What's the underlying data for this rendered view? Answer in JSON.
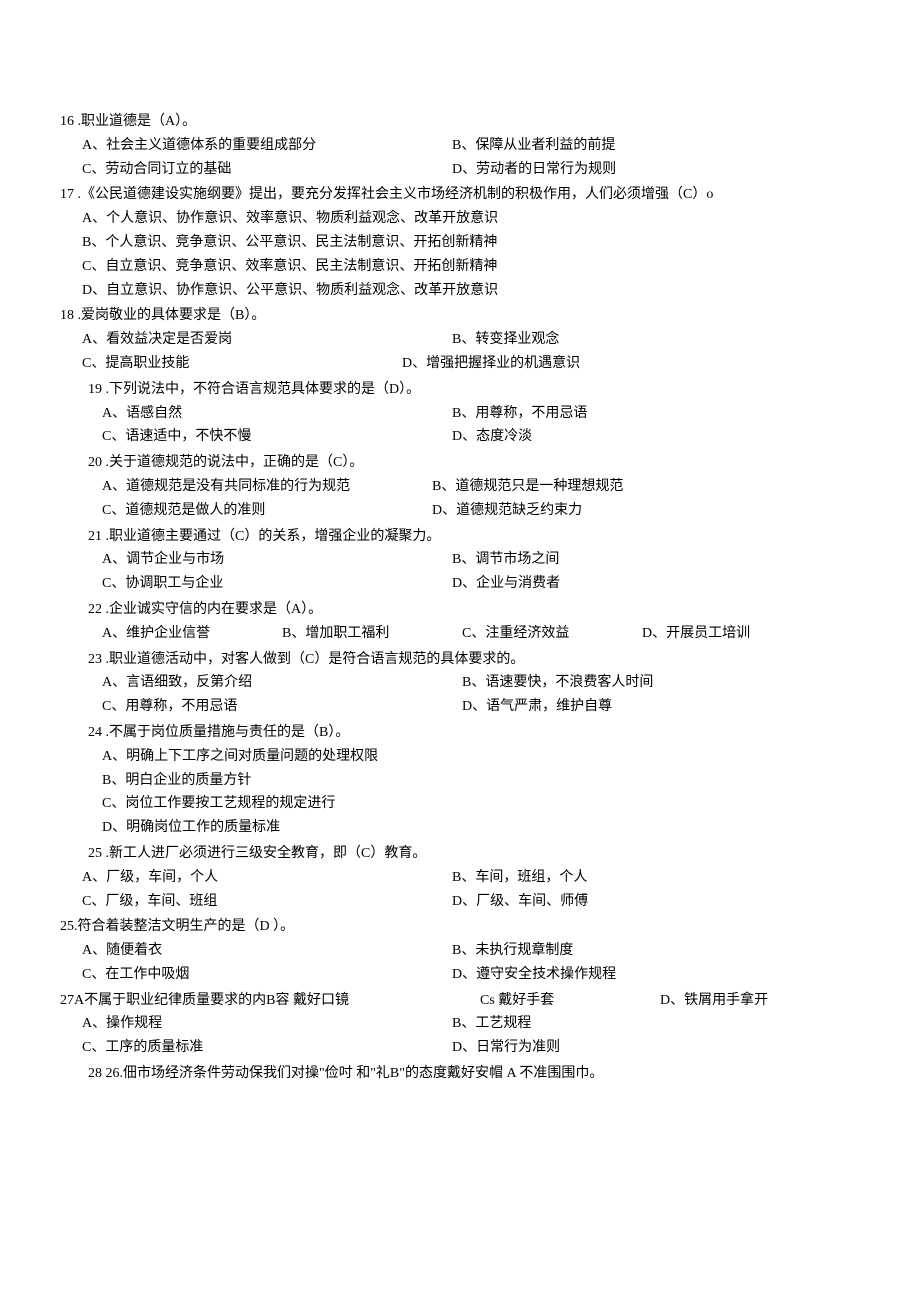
{
  "q16": {
    "stem": "16  .职业道德是（A）。",
    "a": "A、社会主义道德体系的重要组成部分",
    "b": "B、保障从业者利益的前提",
    "c": "C、劳动合同订立的基础",
    "d": "D、劳动者的日常行为规则"
  },
  "q17": {
    "stem": "17  .《公民道德建设实施纲要》提出，要充分发挥社会主义市场经济机制的积极作用，人们必须增强（C）o",
    "a": "A、个人意识、协作意识、效率意识、物质利益观念、改革开放意识",
    "b": "B、个人意识、竞争意识、公平意识、民主法制意识、开拓创新精神",
    "c": "C、自立意识、竞争意识、效率意识、民主法制意识、开拓创新精神",
    "d": "D、自立意识、协作意识、公平意识、物质利益观念、改革开放意识"
  },
  "q18": {
    "stem": "18  .爱岗敬业的具体要求是（B）。",
    "a": "A、看效益决定是否爱岗",
    "b": "B、转变择业观念",
    "c": "C、提高职业技能",
    "d": "D、增强把握择业的机遇意识"
  },
  "q19": {
    "stem": "19  .下列说法中，不符合语言规范具体要求的是（D）。",
    "a": "A、语感自然",
    "b": "B、用尊称，不用忌语",
    "c": "C、语速适中，不快不慢",
    "d": "D、态度冷淡"
  },
  "q20": {
    "stem": "20  .关于道德规范的说法中，正确的是（C）。",
    "a": "A、道德规范是没有共同标准的行为规范",
    "b": "B、道德规范只是一种理想规范",
    "c": "C、道德规范是做人的准则",
    "d": "D、道德规范缺乏约束力"
  },
  "q21": {
    "stem": "21    .职业道德主要通过（C）的关系，增强企业的凝聚力。",
    "a": "A、调节企业与市场",
    "b": "B、调节市场之间",
    "c": "C、协调职工与企业",
    "d": "D、企业与消费者"
  },
  "q22": {
    "stem": "22  .企业诚实守信的内在要求是（A）。",
    "a": "A、维护企业信誉",
    "b": "B、增加职工福利",
    "c": "C、注重经济效益",
    "d": "D、开展员工培训"
  },
  "q23": {
    "stem": "23  .职业道德活动中，对客人做到（C）是符合语言规范的具体要求的。",
    "a": "A、言语细致，反第介绍",
    "b": "B、语速要快，不浪费客人时间",
    "c": "C、用尊称，不用忌语",
    "d": "D、语气严肃，维护自尊"
  },
  "q24": {
    "stem": "24  .不属于岗位质量措施与责任的是（B）。",
    "a": "A、明确上下工序之间对质量问题的处理权限",
    "b": "B、明白企业的质量方针",
    "c": "C、岗位工作要按工艺规程的规定进行",
    "d": "D、明确岗位工作的质量标准"
  },
  "q25a": {
    "stem": "25    .新工人进厂必须进行三级安全教育，即（C）教育。",
    "a": "A、厂级，车间，个人",
    "b": "B、车间，班组，个人",
    "c": "C、厂级，车间、班组",
    "d": "D、厂级、车间、师傅"
  },
  "q25b": {
    "stem": "25.符合着装整洁文明生产的是（D        ）。",
    "a": "A、随便着衣",
    "b": "B、未执行规章制度",
    "c": "C、在工作中吸烟",
    "d": "D、遵守安全技术操作规程"
  },
  "q27": {
    "stem": "27A不属于职业纪律质量要求的内B容 戴好口镜",
    "cs": "Cs 戴好手套",
    "dExtra": "D、铁屑用手拿开",
    "a": "A、操作规程",
    "b": "B、工艺规程",
    "c": "C、工序的质量标准",
    "d": "D、日常行为准则"
  },
  "q28": {
    "stem": "28 26.佃市场经济条件劳动保我们对操\"俭吋 和\"礼B\"的态度戴好安帽 A 不准围围巾。"
  }
}
